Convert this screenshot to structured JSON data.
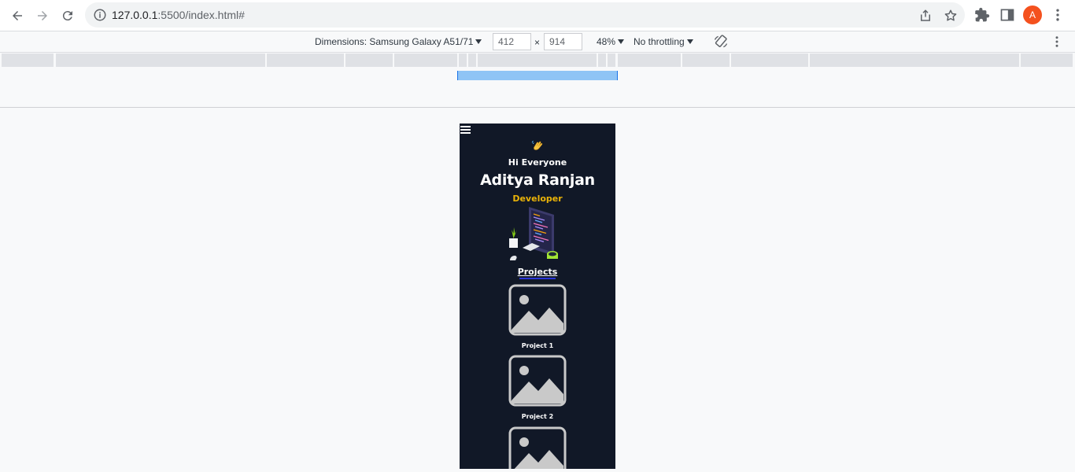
{
  "browser": {
    "url_host": "127.0.0.1",
    "url_rest": ":5500/index.html#",
    "avatar_letter": "A"
  },
  "device_toolbar": {
    "dimensions_label": "Dimensions: Samsung Galaxy A51/71",
    "width": "412",
    "times": "×",
    "height": "914",
    "zoom": "48%",
    "throttling": "No throttling"
  },
  "page": {
    "greeting": "Hi Everyone",
    "name": "Aditya Ranjan",
    "role": "Developer",
    "section_title": "Projects",
    "projects": [
      {
        "label": "Project 1"
      },
      {
        "label": "Project 2"
      }
    ]
  },
  "colors": {
    "page_bg": "#111827",
    "accent_yellow": "#eab308",
    "underline_blue": "#2b36d9",
    "avatar": "#f4511e"
  },
  "icons": [
    "back-icon",
    "forward-icon",
    "reload-icon",
    "info-icon",
    "share-icon",
    "star-icon",
    "extensions-icon",
    "side-panel-icon",
    "menu-dots-icon",
    "rotate-icon",
    "hamburger-icon",
    "wave-icon",
    "image-placeholder-icon"
  ]
}
